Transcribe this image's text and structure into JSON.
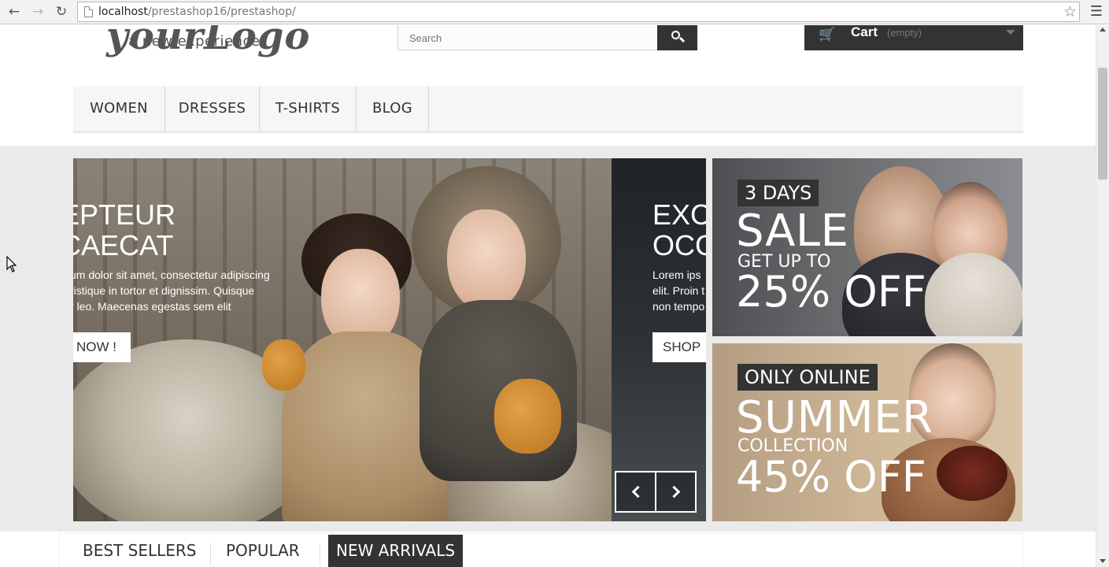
{
  "browser": {
    "url_host": "localhost",
    "url_path": "/prestashop16/prestashop/",
    "icons": {
      "back": "arrow-left",
      "forward": "arrow-right",
      "reload": "reload",
      "bookmark": "star",
      "menu": "hamburger"
    }
  },
  "header": {
    "logo_script": "yourLogo",
    "logo_tagline": "a new experience",
    "search_placeholder": "Search",
    "cart_label": "Cart",
    "cart_qty": "(empty)"
  },
  "menu": {
    "items": [
      {
        "label": "WOMEN"
      },
      {
        "label": "DRESSES"
      },
      {
        "label": "T-SHIRTS"
      },
      {
        "label": "BLOG"
      }
    ]
  },
  "slider": {
    "slide1": {
      "title": "EPTEUR\nCAECAT",
      "text": "um dolor sit amet, consectetur adipiscing\nristique in tortor et dignissim. Quisque\nr leo. Maecenas egestas sem elit",
      "button": "NOW !"
    },
    "slide2": {
      "title": "EXC\nOCC",
      "text": "Lorem ips\nelit. Proin t\nnon tempo",
      "button": "SHOP"
    }
  },
  "promos": [
    {
      "badge": "3 DAYS",
      "headline": "SALE",
      "sub": "GET UP TO",
      "off": "25% OFF"
    },
    {
      "badge": "ONLY ONLINE",
      "headline": "SUMMER",
      "sub": "COLLECTION",
      "off": "45% OFF"
    }
  ],
  "tabs": [
    {
      "label": "BEST SELLERS"
    },
    {
      "label": "POPULAR"
    },
    {
      "label": "NEW ARRIVALS",
      "active": true
    }
  ],
  "colors": {
    "dark": "#333333",
    "band": "#eaeaea",
    "menu_bg": "#f6f6f6"
  }
}
